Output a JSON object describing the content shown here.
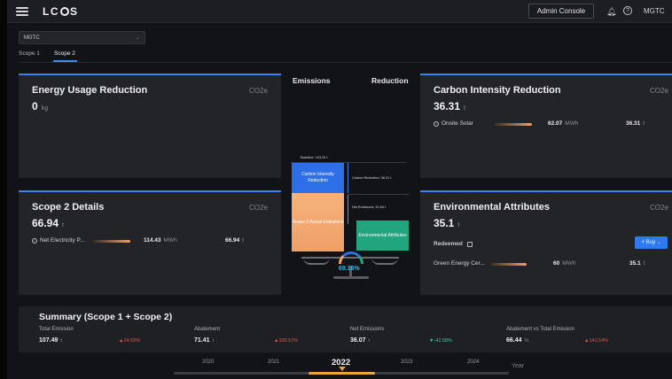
{
  "app": {
    "logo": "LC S",
    "logo_left": "LC",
    "logo_right": "S"
  },
  "header": {
    "admin_console": "Admin Console",
    "user": "MGTC"
  },
  "selector": {
    "value": "MGTC"
  },
  "tabs": [
    {
      "label": "Scope 1"
    },
    {
      "label": "Scope 2",
      "active": true
    }
  ],
  "cards": {
    "energy": {
      "title": "Energy Usage Reduction",
      "unit": "CO2e",
      "value": "0",
      "value_unit": "kg"
    },
    "carbon": {
      "title": "Carbon Intensity Reduction",
      "unit": "CO2e",
      "value": "36.31",
      "value_unit": "t",
      "row": {
        "label": "Onsite Solar",
        "metric": "62.07",
        "metric_unit": "MWh",
        "amount": "36.31",
        "amount_unit": "t",
        "fill": 0.95
      }
    },
    "scope2": {
      "title": "Scope 2 Details",
      "unit": "CO2e",
      "value": "66.94",
      "value_unit": "t",
      "row": {
        "label": "Net Electricity P...",
        "metric": "114.43",
        "metric_unit": "MWh",
        "amount": "66.94",
        "amount_unit": "t",
        "fill": 0.95
      }
    },
    "env": {
      "title": "Environmental Attributes",
      "unit": "CO2e",
      "value": "35.1",
      "value_unit": "t",
      "redeemed": "Redeemed",
      "buy": "+ Buy",
      "row": {
        "label": "Green Energy Cer...",
        "metric": "60",
        "metric_unit": "MWh",
        "amount": "35.1",
        "amount_unit": "t",
        "fill": 0.9
      }
    }
  },
  "center": {
    "emissions_title": "Emissions",
    "reduction_title": "Reduction",
    "baseline": "Baseline: 103.24 t",
    "carbon_box": "Carbon Intensity Reduction",
    "carbon_reduction": "Carbon Reduction: 36.31 t",
    "scope2_box": "Scope 2 Actual Emissions",
    "net_emissions": "Net Emissions: 31.84 t",
    "env_box": "Environmental Attributes",
    "gauge": "69.16%",
    "colors": {
      "blue": "#2e6fe8",
      "orange": "#f3a46a",
      "green": "#20a57d"
    }
  },
  "summary": {
    "title": "Summary (Scope 1 + Scope 2)",
    "items": [
      {
        "label": "Total Emission",
        "value": "107.49",
        "unit": "t",
        "change": "24.02%",
        "dir": "up"
      },
      {
        "label": "Abatement",
        "value": "71.41",
        "unit": "t",
        "change": "199.57%",
        "dir": "up"
      },
      {
        "label": "Net Emissions",
        "value": "36.07",
        "unit": "t",
        "change": "-42.58%",
        "dir": "down"
      },
      {
        "label": "Abatement vs Total Emission",
        "value": "66.44",
        "unit": "%",
        "change": "141.54%",
        "dir": "up"
      }
    ]
  },
  "timeline": {
    "years": [
      "2020",
      "2021",
      "2022",
      "2023",
      "2024"
    ],
    "selected": "2022",
    "label": "Year"
  }
}
